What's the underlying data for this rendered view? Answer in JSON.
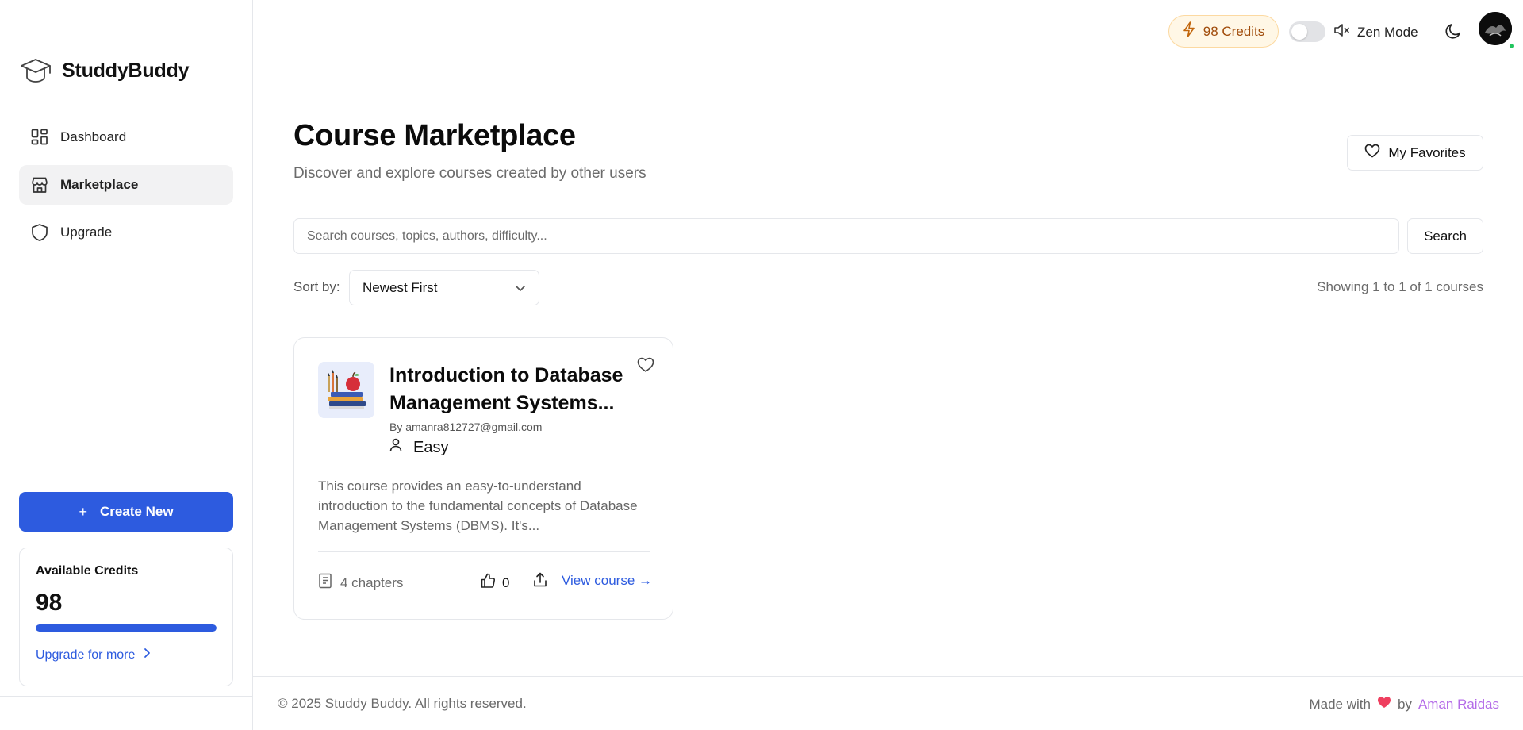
{
  "app": {
    "name": "StuddyBuddy"
  },
  "sidebar": {
    "items": [
      {
        "label": "Dashboard",
        "icon": "grid-icon",
        "active": false
      },
      {
        "label": "Marketplace",
        "icon": "store-icon",
        "active": true
      },
      {
        "label": "Upgrade",
        "icon": "shield-icon",
        "active": false
      }
    ],
    "create_button": {
      "icon": "+",
      "label": "Create New"
    },
    "credits_card": {
      "label": "Available Credits",
      "value": "98",
      "progress": 1.0,
      "upgrade_link": "Upgrade for more"
    }
  },
  "topbar": {
    "credits_label": "98 Credits",
    "zen_toggle_on": false,
    "zen_label": "Zen Mode"
  },
  "main": {
    "title": "Course Marketplace",
    "subtitle": "Discover and explore courses created by other users",
    "favorites_button": "My Favorites",
    "search": {
      "placeholder": "Search courses, topics, authors, difficulty...",
      "value": "",
      "button": "Search"
    },
    "sort": {
      "label": "Sort by:",
      "selected": "Newest First"
    },
    "showing": "Showing 1 to 1 of 1 courses",
    "courses": [
      {
        "title": "Introduction to Database Management Systems...",
        "author": "By amanra812727@gmail.com",
        "difficulty": "Easy",
        "description": "This course provides an easy-to-understand introduction to the fundamental concepts of Database Management Systems (DBMS). It's...",
        "chapters": "4 chapters",
        "likes": "0",
        "view_label": "View course →"
      }
    ]
  },
  "footer": {
    "copyright": "© 2025 Studdy Buddy. All rights reserved.",
    "made_with": "Made with",
    "by": "by",
    "author": "Aman Raidas"
  },
  "colors": {
    "accent": "#2d5bdf",
    "credits_pill_bg": "#fff7e6",
    "credits_pill_text": "#a04b0a",
    "heart": "#ef3f5f",
    "author_link": "#b46be8",
    "online": "#22c55e"
  }
}
